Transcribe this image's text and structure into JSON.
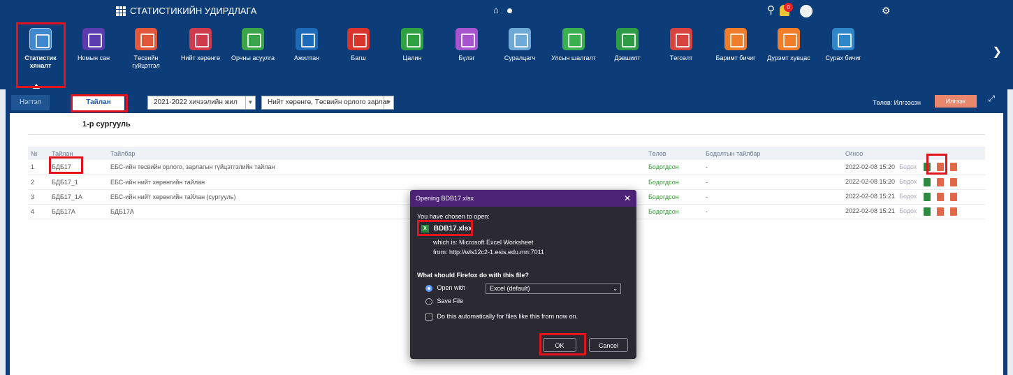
{
  "app": {
    "title": "СТАТИСТИКИЙН УДИРДЛАГА",
    "notif_count": "0"
  },
  "modules": [
    {
      "label": "Статистик хяналт",
      "color": "#3f87cf"
    },
    {
      "label": "Номын сан",
      "color": "#5a3cae"
    },
    {
      "label": "Төсвийн гүйцэтгэл",
      "color": "#e0573a"
    },
    {
      "label": "Нийт хөрөнгө",
      "color": "#cf3a4c"
    },
    {
      "label": "Орчны асуулга",
      "color": "#3aa548"
    },
    {
      "label": "Ажилтан",
      "color": "#1d6bb8"
    },
    {
      "label": "Багш",
      "color": "#d9342b"
    },
    {
      "label": "Цалин",
      "color": "#2ea142"
    },
    {
      "label": "Бүлэг",
      "color": "#a655cf"
    },
    {
      "label": "Суралцагч",
      "color": "#6fa9d6"
    },
    {
      "label": "Улсын шалгалт",
      "color": "#3ab050"
    },
    {
      "label": "Дэвшилт",
      "color": "#2e9b47"
    },
    {
      "label": "Төгсөлт",
      "color": "#d8423f"
    },
    {
      "label": "Баримт бичиг",
      "color": "#ef7d2a"
    },
    {
      "label": "Дүрэмт хувцас",
      "color": "#ef7d2a"
    },
    {
      "label": "Сурах бичиг",
      "color": "#2f86c9"
    }
  ],
  "tabs": {
    "first": "Нэгтэл",
    "active": "Тайлан"
  },
  "filters": {
    "year": "2021-2022 хичээлийн жил",
    "report": "Нийт хөрөнгө, Төсвийн орлого зарлаг"
  },
  "status": {
    "label": "Төлөв: Илгээсэн",
    "send_label": "Илгээх"
  },
  "school": "1-р сургууль",
  "table": {
    "headers": {
      "num": "№",
      "report": "Тайлан",
      "desc": "Тайлбар",
      "status": "Төлөв",
      "note": "Бодолтын тайлбар",
      "date": "Огноо"
    },
    "view_label": "Бодох",
    "rows": [
      {
        "num": "1",
        "report": "БДБ17",
        "desc": "ЕБС-ийн төсвийн орлого, зарлагын гүйцэтгэлийн тайлан",
        "status": "Бодогдсон",
        "note": "-",
        "date": "2022-02-08 15:20"
      },
      {
        "num": "2",
        "report": "БДБ17_1",
        "desc": "ЕБС-ийн нийт хөрөнгийн тайлан",
        "status": "Бодогдсон",
        "note": "-",
        "date": "2022-02-08 15:20"
      },
      {
        "num": "3",
        "report": "БДБ17_1А",
        "desc": "ЕБС-ийн нийт хөрөнгийн тайлан (сургууль)",
        "status": "Бодогдсон",
        "note": "-",
        "date": "2022-02-08 15:21"
      },
      {
        "num": "4",
        "report": "БДБ17А",
        "desc": "БДБ17А",
        "status": "Бодогдсон",
        "note": "-",
        "date": "2022-02-08 15:21"
      }
    ]
  },
  "dialog": {
    "title": "Opening BDB17.xlsx",
    "chosen": "You have chosen to open:",
    "filename": "BDB17.xlsx",
    "which_is": "which is:  Microsoft Excel Worksheet",
    "from": "from:  http://wls12c2-1.esis.edu.mn:7011",
    "question": "What should Firefox do with this file?",
    "open_with": "Open with",
    "open_app": "Excel (default)",
    "save_file": "Save File",
    "auto": "Do this automatically for files like this from now on.",
    "ok": "OK",
    "cancel": "Cancel"
  }
}
